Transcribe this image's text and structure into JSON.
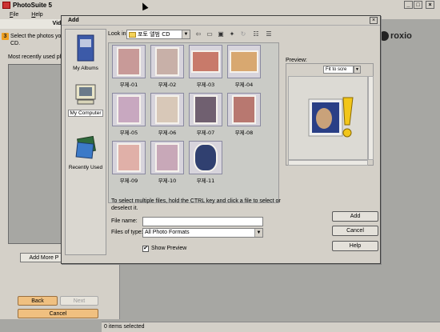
{
  "app": {
    "title": "PhotoSuite 5",
    "menu": [
      "File",
      "Help"
    ],
    "controls": [
      "_",
      "□",
      "×"
    ]
  },
  "left_panel": {
    "header": "Video",
    "step": "3",
    "instruction": "Select the photos you w... on your Video CD.",
    "recent_label": "Most recently used phot",
    "add_more": "Add More P",
    "back": "Back",
    "next": "Next",
    "cancel": "Cancel"
  },
  "brand": "roxio",
  "status": "0 items selected",
  "dialog": {
    "title": "Add",
    "close": "×",
    "places": [
      {
        "label": "My Albums",
        "selected": false
      },
      {
        "label": "My Computer",
        "selected": true
      },
      {
        "label": "Recently Used",
        "selected": false
      }
    ],
    "look_in_label": "Look in:",
    "look_in_value": "포토 앨범 CD",
    "files": [
      {
        "label": "무제-01",
        "color": "#c89a98"
      },
      {
        "label": "무제-02",
        "color": "#c8b0a8"
      },
      {
        "label": "무제-03",
        "color": "#c87a6a"
      },
      {
        "label": "무제-04",
        "color": "#d8a870"
      },
      {
        "label": "무제-05",
        "color": "#c8a8c0"
      },
      {
        "label": "무제-06",
        "color": "#d8c8b8"
      },
      {
        "label": "무제-07",
        "color": "#706070"
      },
      {
        "label": "무제-08",
        "color": "#b87870"
      },
      {
        "label": "무제-09",
        "color": "#e0b0a8"
      },
      {
        "label": "무제-10",
        "color": "#c8a8b8"
      },
      {
        "label": "무제-11",
        "color": "#304070"
      }
    ],
    "preview_label": "Preview:",
    "preview_zoom": "Fit to scre",
    "hint": "To select multiple files, hold the CTRL key and click a file to select or deselect it.",
    "file_name_label": "File name:",
    "file_name_value": "",
    "files_of_type_label": "Files of type:",
    "files_of_type_value": "All Photo Formats",
    "show_preview_label": "Show Preview",
    "show_preview_checked": "✔",
    "buttons": {
      "add": "Add",
      "cancel": "Cancel",
      "help": "Help"
    }
  }
}
